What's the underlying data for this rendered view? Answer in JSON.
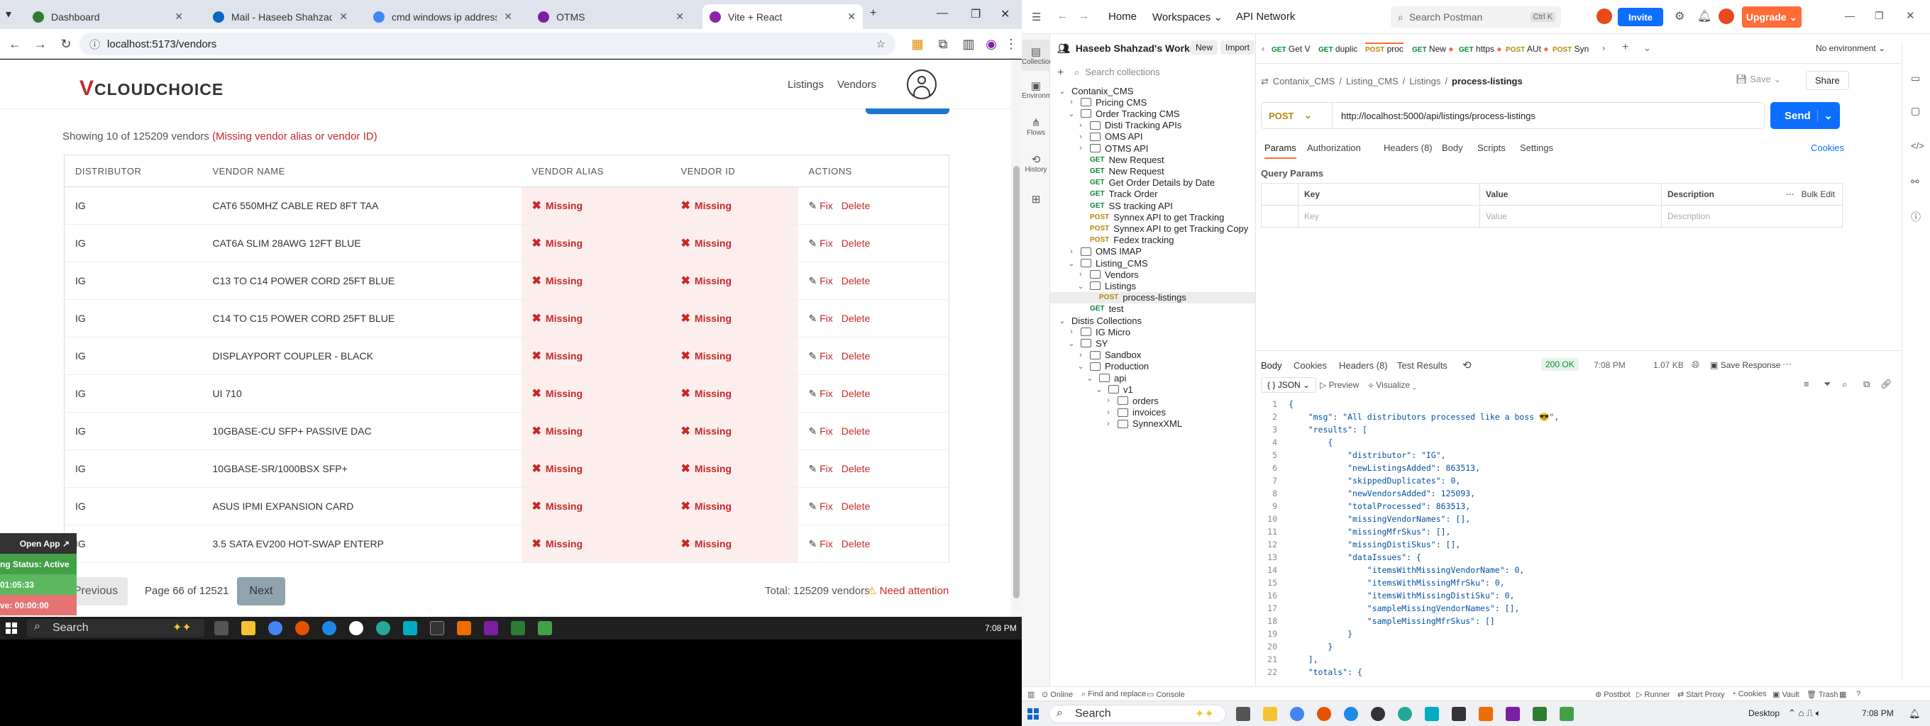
{
  "browser": {
    "tabs": [
      {
        "title": "Dashboard",
        "color": "#2e7d32"
      },
      {
        "title": "Mail - Haseeb Shahzad - Outlo",
        "color": "#0a66c2"
      },
      {
        "title": "cmd windows ip address - Goo",
        "color": "#4285f4"
      },
      {
        "title": "OTMS",
        "color": "#7b1fa2"
      },
      {
        "title": "Vite + React",
        "color": "#8e24aa"
      }
    ],
    "url": "localhost:5173/vendors"
  },
  "site": {
    "logo_v": "V",
    "logo_text": "CLOUDCHOICE",
    "nav": [
      "Listings",
      "Vendors"
    ]
  },
  "summary": {
    "text": "Showing 10 of 125209 vendors",
    "note": "(Missing vendor alias or vendor ID)"
  },
  "table": {
    "headers": [
      "DISTRIBUTOR",
      "VENDOR NAME",
      "VENDOR ALIAS",
      "VENDOR ID",
      "ACTIONS"
    ],
    "missing_label": "Missing",
    "fix_label": "Fix",
    "delete_label": "Delete",
    "rows": [
      {
        "distributor": "IG",
        "vendor": "CAT6 550MHZ CABLE RED 8FT TAA"
      },
      {
        "distributor": "IG",
        "vendor": "CAT6A SLIM 28AWG 12FT BLUE"
      },
      {
        "distributor": "IG",
        "vendor": "C13 TO C14 POWER CORD 25FT BLUE"
      },
      {
        "distributor": "IG",
        "vendor": "C14 TO C15 POWER CORD 25FT BLUE"
      },
      {
        "distributor": "IG",
        "vendor": "DISPLAYPORT COUPLER - BLACK"
      },
      {
        "distributor": "IG",
        "vendor": "UI 710"
      },
      {
        "distributor": "IG",
        "vendor": "10GBASE-CU SFP+ PASSIVE DAC"
      },
      {
        "distributor": "IG",
        "vendor": "10GBASE-SR/1000BSX SFP+"
      },
      {
        "distributor": "IG",
        "vendor": "ASUS IPMI EXPANSION CARD"
      },
      {
        "distributor": "IG",
        "vendor": "3.5 SATA EV200 HOT-SWAP ENTERP"
      }
    ]
  },
  "pager": {
    "previous": "Previous",
    "page_info": "Page 66 of 12521",
    "next": "Next",
    "total": "Total: 125209 vendors",
    "attention": "Need attention"
  },
  "overlay": {
    "open_app": "Open App",
    "status": "ng Status: Active",
    "timer1": "01:05:33",
    "timer2": "ve: 00:00:00"
  },
  "taskbar_left": {
    "search": "Search",
    "time": "7:08 PM"
  },
  "postman": {
    "home": "Home",
    "workspaces": "Workspaces",
    "api_network": "API Network",
    "search": "Search Postman",
    "shortcut": "Ctrl K",
    "invite": "Invite",
    "upgrade": "Upgrade",
    "workspace_name": "Haseeb Shahzad's Workspace",
    "new": "New",
    "import": "Import",
    "search_collections": "Search collections",
    "side_icons": [
      "Collections",
      "Environments",
      "Flows",
      "History"
    ],
    "tabs": [
      {
        "method": "GET",
        "name": "Get V"
      },
      {
        "method": "GET",
        "name": "duplic"
      },
      {
        "method": "POST",
        "name": "proc"
      },
      {
        "method": "GET",
        "name": "New"
      },
      {
        "method": "GET",
        "name": "https"
      },
      {
        "method": "POST",
        "name": "AUt"
      },
      {
        "method": "POST",
        "name": "Syn"
      }
    ],
    "no_env": "No environment",
    "breadcrumb": [
      "Contanix_CMS",
      "Listing_CMS",
      "Listings",
      "process-listings"
    ],
    "save": "Save",
    "share": "Share",
    "method": "POST",
    "request_url": "http://localhost:5000/api/listings/process-listings",
    "send": "Send",
    "req_tabs": [
      "Params",
      "Authorization",
      "Headers (8)",
      "Body",
      "Scripts",
      "Settings"
    ],
    "cookies": "Cookies",
    "query_params": "Query Params",
    "qp_headers": [
      "Key",
      "Value",
      "Description"
    ],
    "bulk_edit": "Bulk Edit",
    "qp_placeholders": [
      "Key",
      "Value",
      "Description"
    ],
    "resp_tabs": [
      "Body",
      "Cookies",
      "Headers (8)",
      "Test Results"
    ],
    "status": "200 OK",
    "time": "7:08 PM",
    "size": "1.07 KB",
    "save_response": "Save Response",
    "format": "JSON",
    "preview": "Preview",
    "visualize": "Visualize",
    "tree": [
      {
        "label": "Contanix_CMS",
        "type": "root"
      },
      {
        "label": "Pricing CMS",
        "type": "folder"
      },
      {
        "label": "Order Tracking CMS",
        "type": "folder"
      },
      {
        "label": "Disti Tracking APIs",
        "type": "folder"
      },
      {
        "label": "OMS API",
        "type": "folder"
      },
      {
        "label": "OTMS API",
        "type": "folder"
      },
      {
        "label": "New Request",
        "type": "req",
        "method": "GET"
      },
      {
        "label": "New Request",
        "type": "req",
        "method": "GET"
      },
      {
        "label": "Get Order Details by Date",
        "type": "req",
        "method": "GET"
      },
      {
        "label": "Track Order",
        "type": "req",
        "method": "GET"
      },
      {
        "label": "SS tracking API",
        "type": "req",
        "method": "GET"
      },
      {
        "label": "Synnex API to get Tracking",
        "type": "req",
        "method": "POST"
      },
      {
        "label": "Synnex API to get Tracking Copy",
        "type": "req",
        "method": "POST"
      },
      {
        "label": "Fedex tracking",
        "type": "req",
        "method": "POST"
      },
      {
        "label": "OMS IMAP",
        "type": "folder"
      },
      {
        "label": "Listing_CMS",
        "type": "folder"
      },
      {
        "label": "Vendors",
        "type": "folder"
      },
      {
        "label": "Listings",
        "type": "folder"
      },
      {
        "label": "process-listings",
        "type": "req",
        "method": "POST"
      },
      {
        "label": "test",
        "type": "req",
        "method": "GET"
      },
      {
        "label": "Distis Collections",
        "type": "root"
      },
      {
        "label": "IG Micro",
        "type": "folder"
      },
      {
        "label": "SY",
        "type": "folder"
      },
      {
        "label": "Sandbox",
        "type": "folder"
      },
      {
        "label": "Production",
        "type": "folder"
      },
      {
        "label": "api",
        "type": "folder"
      },
      {
        "label": "v1",
        "type": "folder"
      },
      {
        "label": "orders",
        "type": "folder"
      },
      {
        "label": "invoices",
        "type": "folder"
      },
      {
        "label": "SynnexXML",
        "type": "folder"
      }
    ],
    "json_lines": [
      "{",
      "    \"msg\": \"All distributors processed like a boss 😎\",",
      "    \"results\": [",
      "        {",
      "            \"distributor\": \"IG\",",
      "            \"newListingsAdded\": 863513,",
      "            \"skippedDuplicates\": 0,",
      "            \"newVendorsAdded\": 125093,",
      "            \"totalProcessed\": 863513,",
      "            \"missingVendorNames\": [],",
      "            \"missingMfrSkus\": [],",
      "            \"missingDistiSkus\": [],",
      "            \"dataIssues\": {",
      "                \"itemsWithMissingVendorName\": 0,",
      "                \"itemsWithMissingMfrSku\": 0,",
      "                \"itemsWithMissingDistiSku\": 0,",
      "                \"sampleMissingVendorNames\": [],",
      "                \"sampleMissingMfrSkus\": []",
      "            }",
      "        }",
      "    ],",
      "    \"totals\": {"
    ],
    "status_bar": [
      "Online",
      "Find and replace",
      "Console",
      "Postbot",
      "Runner",
      "Start Proxy",
      "Cookies",
      "Vault",
      "Trash"
    ],
    "taskbar_search": "Search",
    "desktop": "Desktop"
  }
}
